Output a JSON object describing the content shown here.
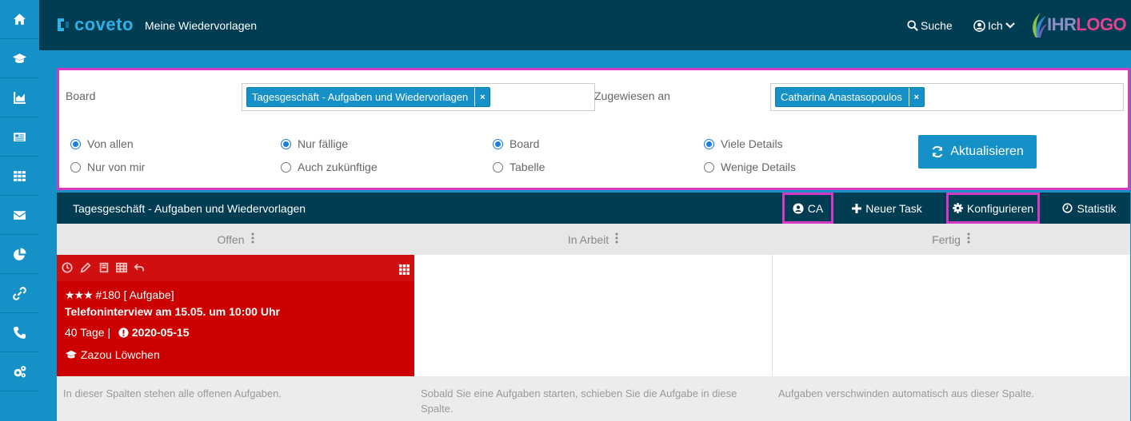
{
  "app": {
    "logo_text": "coveto",
    "page_title": "Meine Wiedervorlagen",
    "search_label": "Suche",
    "user_label": "Ich",
    "brand_ihr": "IHR",
    "brand_logo": "LOGO"
  },
  "sidebar": {
    "items": [
      {
        "icon": "home-icon"
      },
      {
        "icon": "graduation-cap-icon"
      },
      {
        "icon": "chart-icon"
      },
      {
        "icon": "newspaper-icon"
      },
      {
        "icon": "grid-icon"
      },
      {
        "icon": "envelope-icon"
      },
      {
        "icon": "pie-chart-icon"
      },
      {
        "icon": "link-icon"
      },
      {
        "icon": "phone-icon"
      },
      {
        "icon": "cogs-icon"
      }
    ]
  },
  "filters": {
    "board_label": "Board",
    "board_value": "Tagesgeschäft - Aufgaben und Wiedervorlagen",
    "assigned_label": "Zugewiesen an",
    "assigned_value": "Catharina Anastasopoulos",
    "radio_groups": [
      {
        "options": [
          "Von allen",
          "Nur von mir"
        ],
        "selected": "Von allen"
      },
      {
        "options": [
          "Nur fällige",
          "Auch zukünftige"
        ],
        "selected": "Nur fällige"
      },
      {
        "options": [
          "Board",
          "Tabelle"
        ],
        "selected": "Board"
      },
      {
        "options": [
          "Viele Details",
          "Wenige Details"
        ],
        "selected": "Viele Details"
      }
    ],
    "refresh_label": "Aktualisieren"
  },
  "board": {
    "title": "Tagesgeschäft - Aufgaben und Wiedervorlagen",
    "ca_label": "CA",
    "new_task_label": "Neuer Task",
    "configure_label": "Konfigurieren",
    "stats_label": "Statistik"
  },
  "columns": [
    {
      "title": "Offen",
      "footer": "In dieser Spalten stehen alle offenen Aufgaben."
    },
    {
      "title": "In Arbeit",
      "footer": "Sobald Sie eine Aufgaben starten, schieben Sie die Aufgabe in diese Spalte."
    },
    {
      "title": "Fertig",
      "footer": "Aufgaben verschwinden automatisch aus dieser Spalte."
    }
  ],
  "card": {
    "stars": "★★★",
    "id_type": "#180 [ Aufgabe]",
    "title": "Telefoninterview am 15.05. um 10:00 Uhr",
    "days": "40 Tage |",
    "due_date": "2020-05-15",
    "candidate": "Zazou Löwchen",
    "color": "#cc0000"
  },
  "colors": {
    "sidebar": "#1591c8",
    "topbar": "#003c52",
    "accent": "#1591c8",
    "highlight": "#d63ac4"
  }
}
